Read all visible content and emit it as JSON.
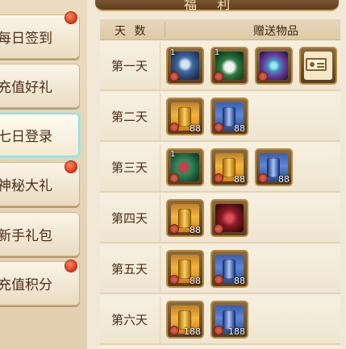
{
  "window": {
    "title": "福 利"
  },
  "sidebar": {
    "items": [
      {
        "label": "每日签到",
        "active": false,
        "badge": true
      },
      {
        "label": "充值好礼",
        "active": false,
        "badge": false
      },
      {
        "label": "七日登录",
        "active": true,
        "badge": false
      },
      {
        "label": "神秘大礼",
        "active": false,
        "badge": true
      },
      {
        "label": "新手礼包",
        "active": false,
        "badge": false
      },
      {
        "label": "充值积分",
        "active": false,
        "badge": true
      }
    ]
  },
  "table": {
    "header_days": "天 数",
    "header_gifts": "赠送物品",
    "rows": [
      {
        "day": "第一天",
        "items": [
          {
            "icon": "tiger-mount-icon",
            "level": "1",
            "qty": ""
          },
          {
            "icon": "panda-mount-icon",
            "level": "1",
            "qty": ""
          },
          {
            "icon": "crest-emblem-icon",
            "level": "",
            "qty": ""
          },
          {
            "icon": "name-card-icon",
            "level": "",
            "qty": ""
          }
        ]
      },
      {
        "day": "第二天",
        "items": [
          {
            "icon": "gold-firework-icon",
            "level": "",
            "qty": "88"
          },
          {
            "icon": "blue-firework-icon",
            "level": "",
            "qty": "88"
          }
        ]
      },
      {
        "day": "第三天",
        "items": [
          {
            "icon": "green-dragon-icon",
            "level": "1",
            "qty": ""
          },
          {
            "icon": "gold-firework-icon",
            "level": "",
            "qty": "88"
          },
          {
            "icon": "blue-firework-icon",
            "level": "",
            "qty": "88"
          }
        ]
      },
      {
        "day": "第四天",
        "items": [
          {
            "icon": "gold-firework-icon",
            "level": "",
            "qty": "88"
          },
          {
            "icon": "red-dragon-icon",
            "level": "",
            "qty": ""
          }
        ]
      },
      {
        "day": "第五天",
        "items": [
          {
            "icon": "gold-firework-icon",
            "level": "",
            "qty": "88"
          },
          {
            "icon": "blue-firework-icon",
            "level": "",
            "qty": "88"
          }
        ]
      },
      {
        "day": "第六天",
        "items": [
          {
            "icon": "gold-firework-icon",
            "level": "",
            "qty": "188"
          },
          {
            "icon": "blue-firework-icon",
            "level": "",
            "qty": "188"
          }
        ]
      }
    ]
  },
  "colors": {
    "badge": "#d4381c",
    "active_outline": "#8fe3e6",
    "text_brown": "#4a2e18"
  }
}
